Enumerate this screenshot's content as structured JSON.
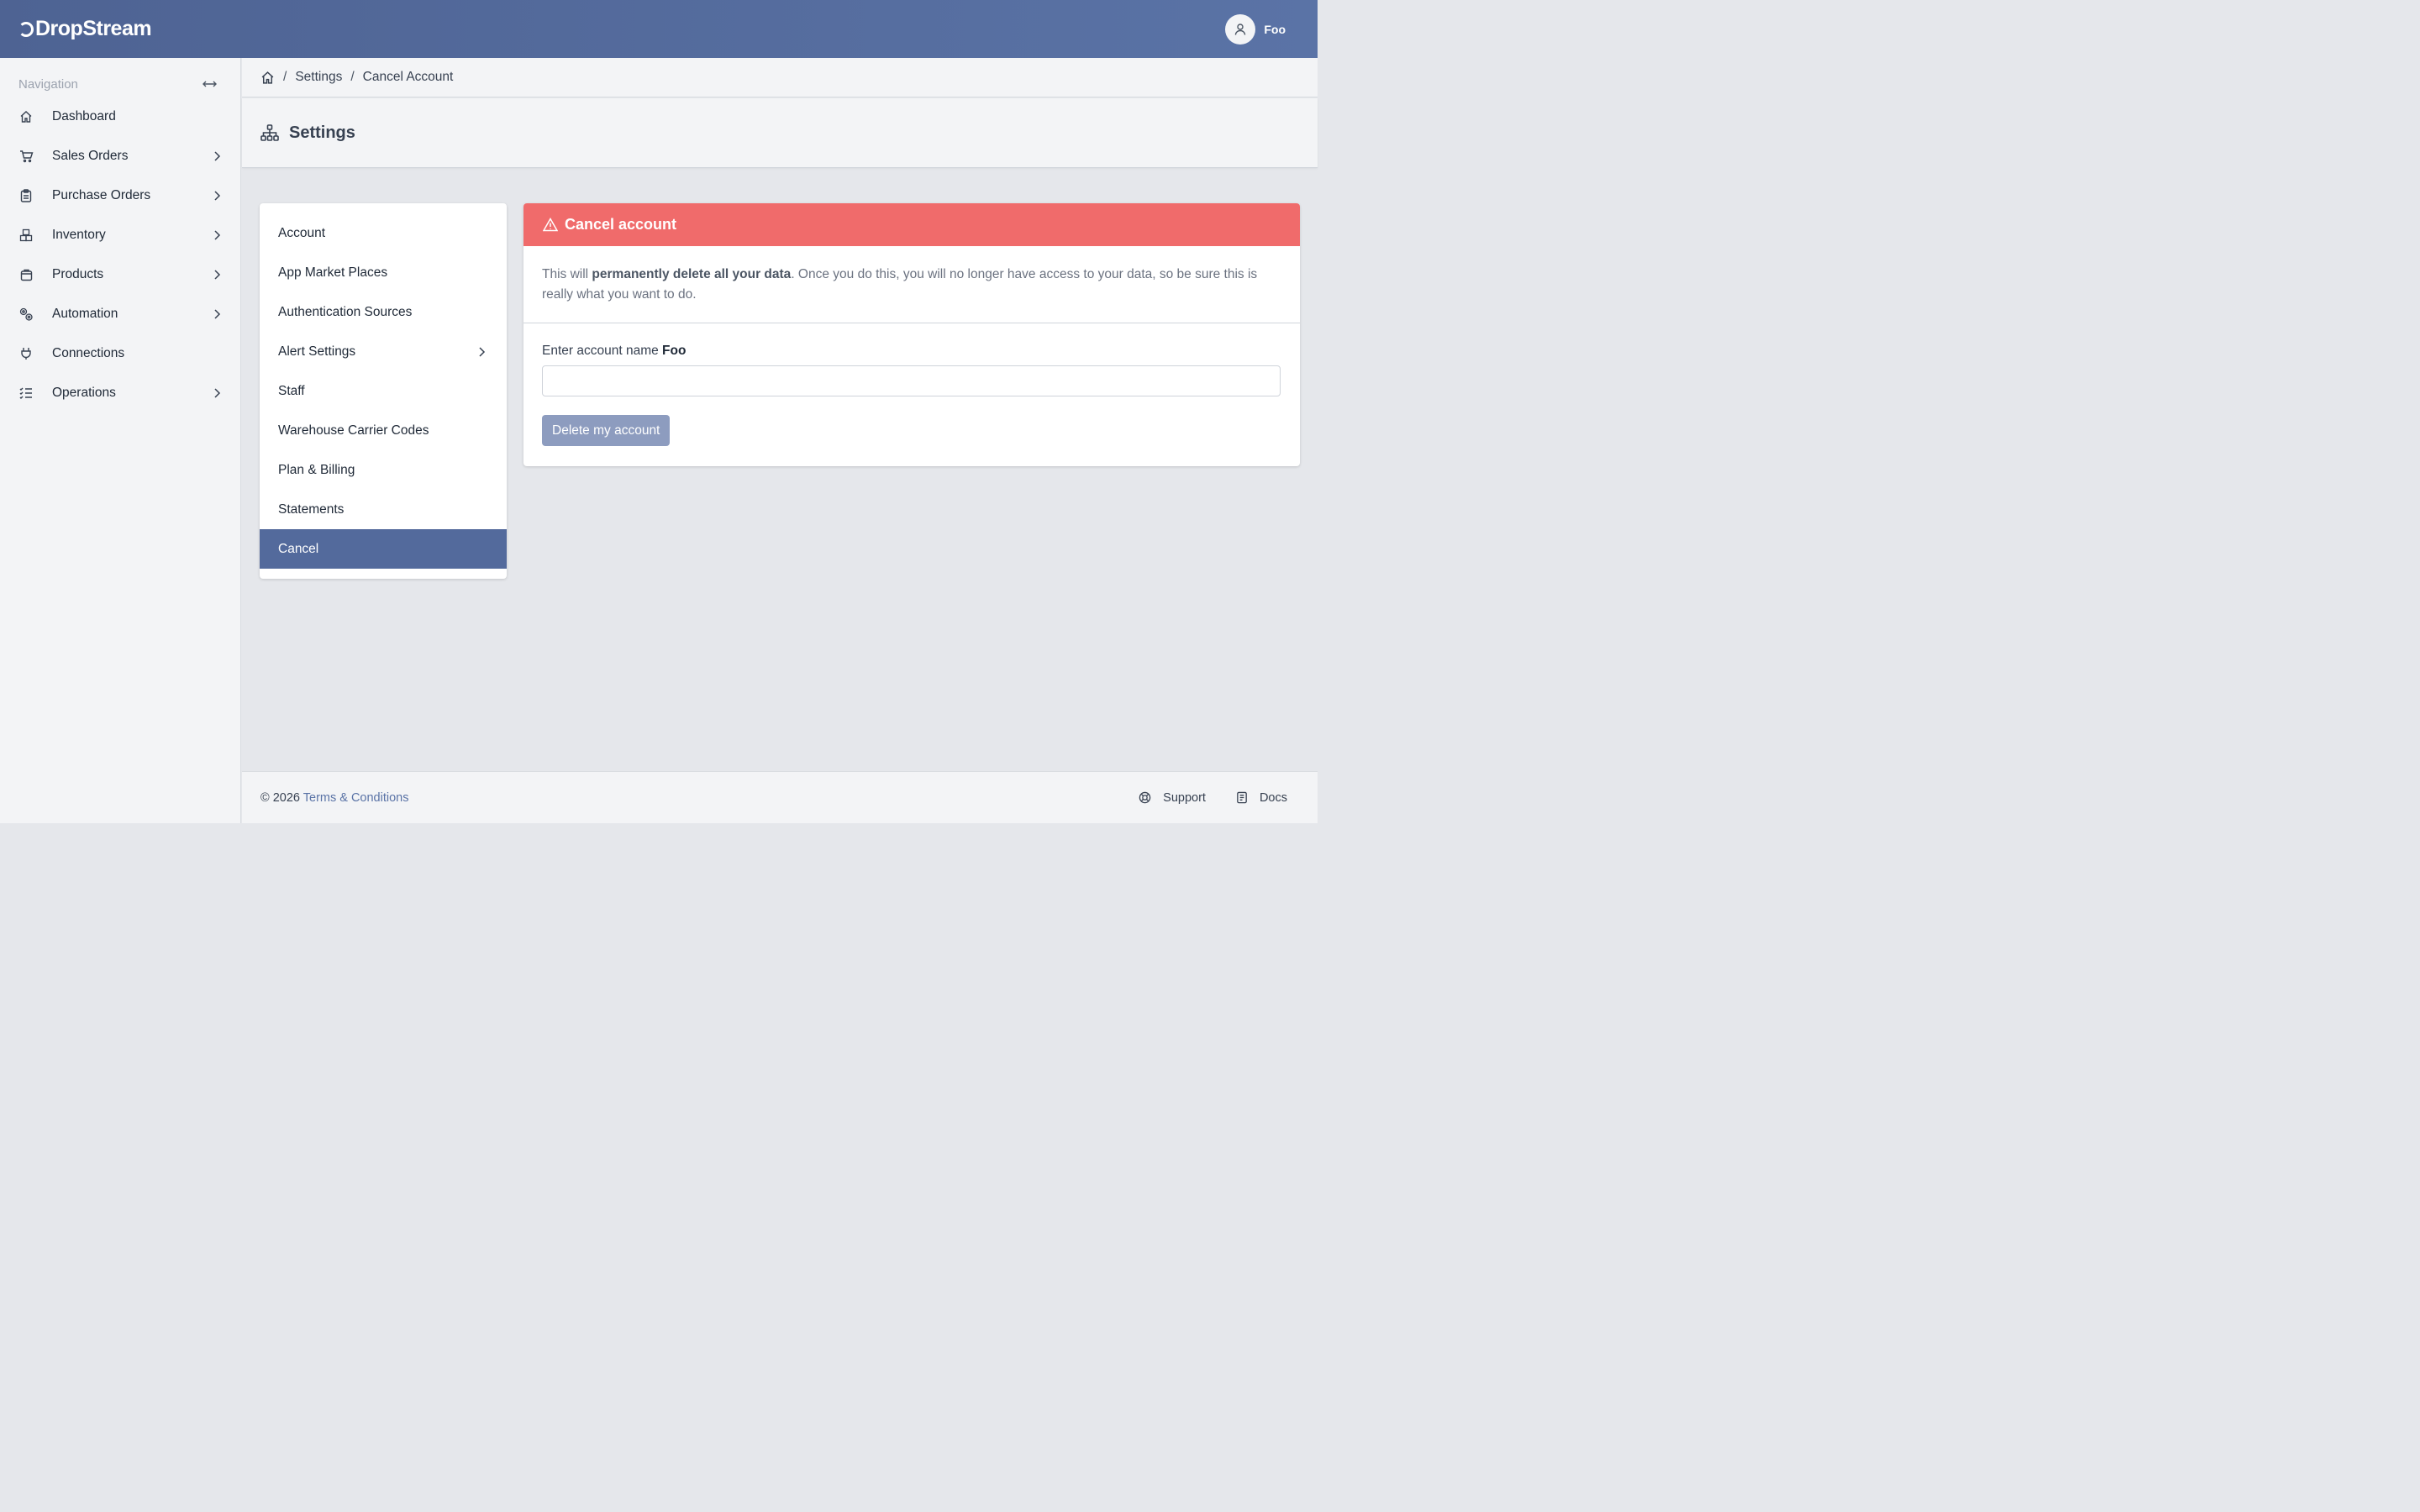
{
  "app": {
    "brand": "DropStream",
    "user_name": "Foo"
  },
  "sidebar": {
    "heading": "Navigation",
    "items": [
      {
        "label": "Dashboard",
        "icon": "home-icon",
        "has_children": false
      },
      {
        "label": "Sales Orders",
        "icon": "cart-icon",
        "has_children": true
      },
      {
        "label": "Purchase Orders",
        "icon": "clipboard-icon",
        "has_children": true
      },
      {
        "label": "Inventory",
        "icon": "boxes-icon",
        "has_children": true
      },
      {
        "label": "Products",
        "icon": "bag-icon",
        "has_children": true
      },
      {
        "label": "Automation",
        "icon": "gears-icon",
        "has_children": true
      },
      {
        "label": "Connections",
        "icon": "plug-icon",
        "has_children": false
      },
      {
        "label": "Operations",
        "icon": "list-check-icon",
        "has_children": true
      }
    ]
  },
  "breadcrumb": {
    "items": [
      "Settings",
      "Cancel Account"
    ]
  },
  "page": {
    "title": "Settings"
  },
  "settings_menu": {
    "items": [
      {
        "label": "Account"
      },
      {
        "label": "App Market Places"
      },
      {
        "label": "Authentication Sources"
      },
      {
        "label": "Alert Settings"
      },
      {
        "label": "Staff"
      },
      {
        "label": "Warehouse Carrier Codes"
      },
      {
        "label": "Plan & Billing"
      },
      {
        "label": "Statements"
      },
      {
        "label": "Cancel"
      }
    ],
    "active": "Cancel"
  },
  "cancel_panel": {
    "title": "Cancel account",
    "warning_prefix": "This will ",
    "warning_bold": "permanently delete all your data",
    "warning_suffix": ". Once you do this, you will no longer have access to your data, so be sure this is really what you want to do.",
    "field_label": "Enter account name ",
    "field_label_bold": "Foo",
    "field_value": "",
    "field_placeholder": "",
    "delete_button": "Delete my account"
  },
  "footer": {
    "copyright": "© 2026 ",
    "terms_link": "Terms & Conditions",
    "support": "Support",
    "docs": "Docs"
  },
  "colors": {
    "header": "#536a9c",
    "active_item": "#536a9c",
    "danger": "#f06b6b",
    "disabled_button": "#8d9cbf",
    "link": "#5a73a6"
  }
}
